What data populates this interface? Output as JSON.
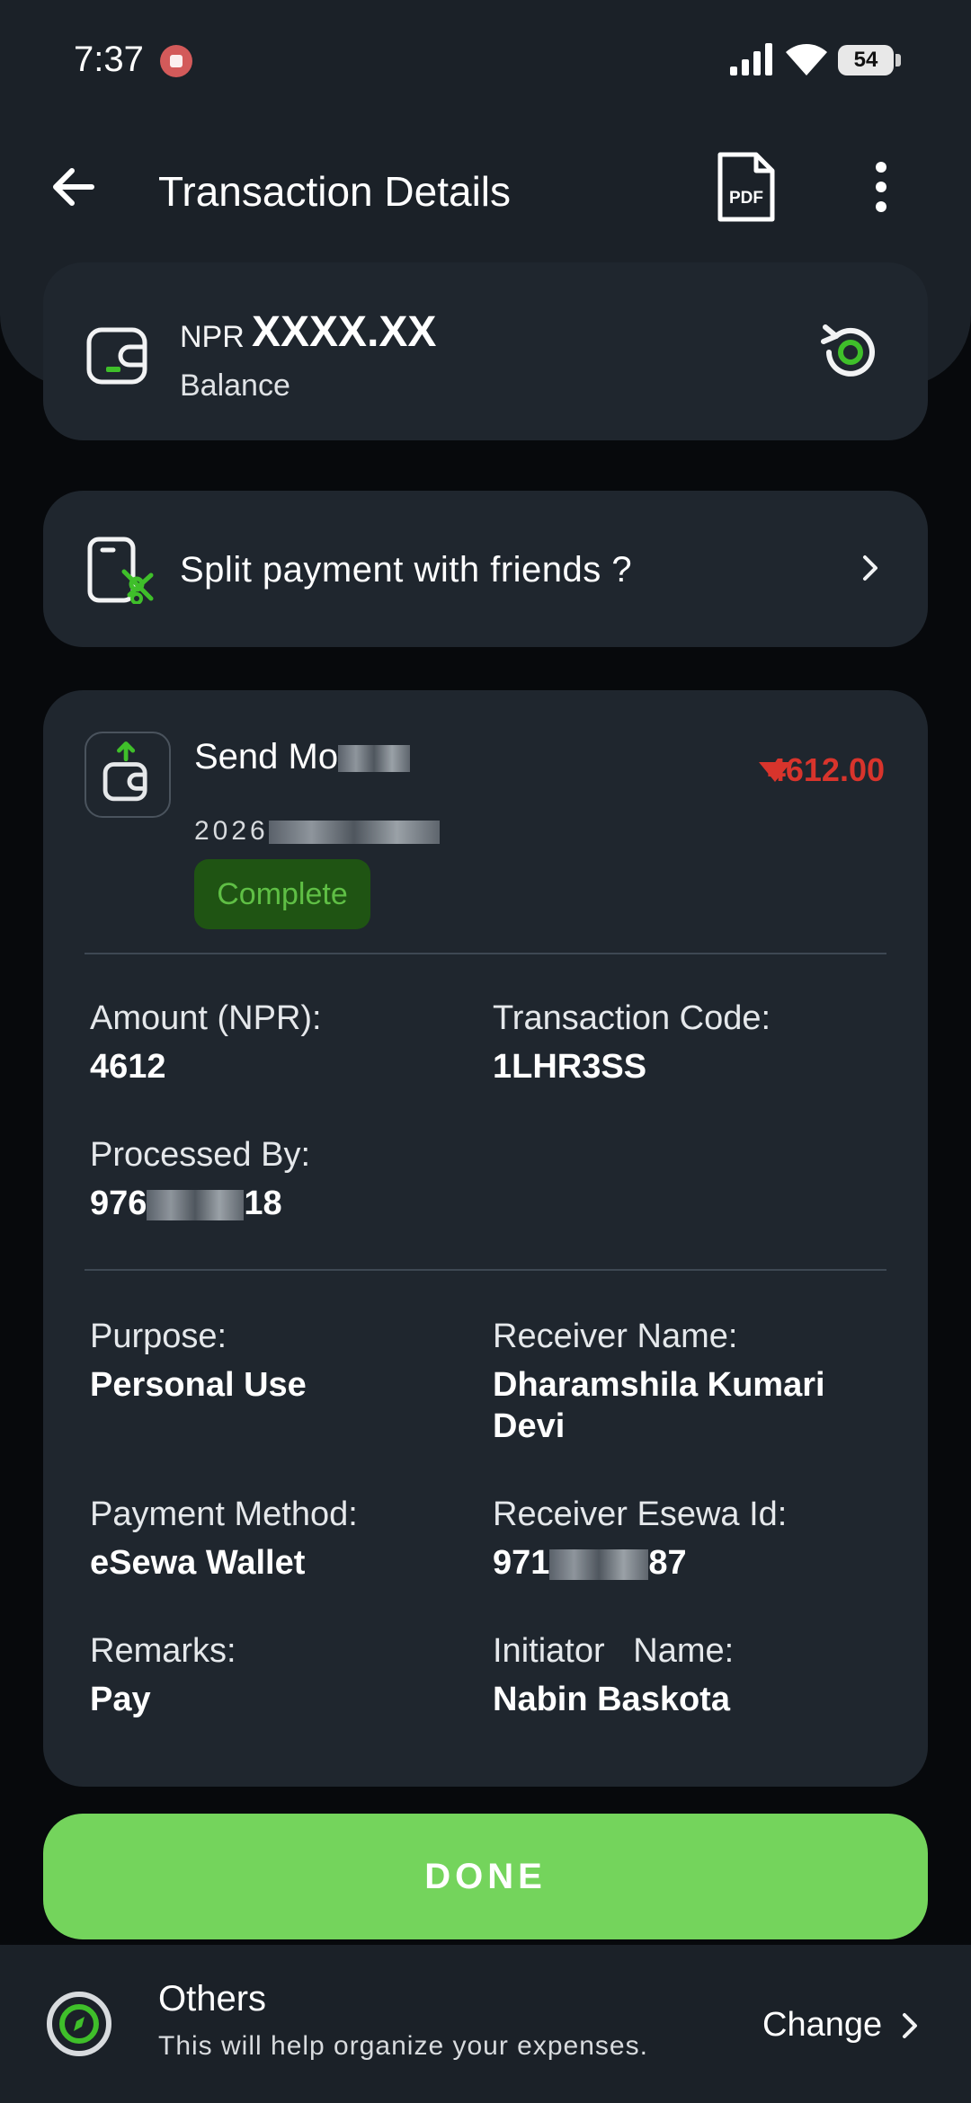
{
  "status_bar": {
    "time": "7:37",
    "battery": "54"
  },
  "header": {
    "title": "Transaction Details",
    "pdf_label": "PDF"
  },
  "balance": {
    "currency": "NPR",
    "amount": "XXXX.XX",
    "label": "Balance"
  },
  "split": {
    "label": "Split payment with friends ?"
  },
  "transaction": {
    "title_visible": "Send Mo",
    "date_visible": "2026",
    "status": "Complete",
    "amount": "4612.00",
    "amount_color": "#d8342c",
    "fields": {
      "amount_label": "Amount (NPR):",
      "amount_value": "4612",
      "code_label": "Transaction Code:",
      "code_value": "1LHR3SS",
      "processed_label": "Processed By:",
      "processed_prefix": "976",
      "processed_suffix": "18",
      "purpose_label": "Purpose:",
      "purpose_value": "Personal Use",
      "receiver_label": "Receiver Name:",
      "receiver_value": "Dharamshila Kumari Devi",
      "method_label": "Payment Method:",
      "method_value": "eSewa Wallet",
      "esewa_label": "Receiver Esewa Id:",
      "esewa_prefix": "971",
      "esewa_suffix": "87",
      "remarks_label": "Remarks:",
      "remarks_value": "Pay",
      "initiator_label": "Initiator   Name:",
      "initiator_value": "Nabin Baskota"
    }
  },
  "done_button": {
    "label": "DONE",
    "color": "#74d45c"
  },
  "category": {
    "title": "Others",
    "subtitle": "This will help organize your expenses.",
    "change_label": "Change"
  },
  "colors": {
    "accent_green": "#74d45c",
    "card_bg": "#1f262e",
    "debit_red": "#d8342c"
  }
}
